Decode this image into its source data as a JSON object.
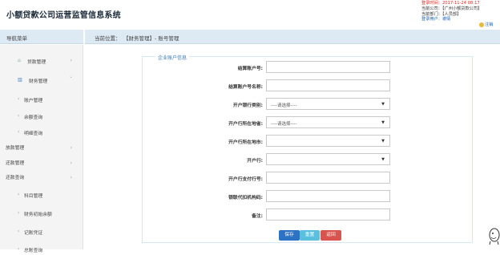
{
  "app": {
    "title": "小额贷款公司运营监管信息系统"
  },
  "user_info": {
    "login_time": "登录时间：2017-11-24 08:17",
    "company": "当前公司：【广州小额贷款公司】",
    "department": "当前部门：【人员部】",
    "user": "登录用户：谢倩",
    "logout": "注销"
  },
  "nav": {
    "header": "导航菜单"
  },
  "breadcrumb": {
    "prefix": "当前位置：",
    "path": "【财务管理】- 账号管理"
  },
  "sidebar": {
    "items": [
      {
        "label": "贷款管理",
        "icon": "home-icon",
        "arrow": "chevron-right"
      },
      {
        "label": "财务管理",
        "icon": "chart-icon",
        "arrow": "chevron-down"
      },
      {
        "label": "账户管理"
      },
      {
        "label": "余额查询"
      },
      {
        "label": "明细查询"
      },
      {
        "label": "放款管理"
      },
      {
        "label": "还款管理"
      },
      {
        "label": "还款查询"
      },
      {
        "label": "科目管理"
      },
      {
        "label": "财务初始余额"
      },
      {
        "label": "记账凭证"
      },
      {
        "label": "总账查询"
      }
    ]
  },
  "form": {
    "legend": "企业账户信息",
    "fields": [
      {
        "label": "结算账户号:",
        "value": ""
      },
      {
        "label": "结算账户号名称:",
        "value": ""
      },
      {
        "label": "开户银行类别:",
        "value": "----请选择----"
      },
      {
        "label": "开户行所在地省:",
        "value": "----请选择----"
      },
      {
        "label": "开户行所在地市:",
        "value": ""
      },
      {
        "label": "开户行:",
        "value": ""
      },
      {
        "label": "开户行支付行号:",
        "value": ""
      },
      {
        "label": "银联代扣机构码:",
        "value": ""
      },
      {
        "label": "备注:",
        "value": ""
      }
    ],
    "buttons": {
      "save": "保存",
      "reset": "重置",
      "back": "返回"
    }
  },
  "colors": {
    "primary": "#2c73c5",
    "info": "#5bc0de",
    "danger": "#d9534f",
    "nav_bg": "#dde9f3"
  }
}
